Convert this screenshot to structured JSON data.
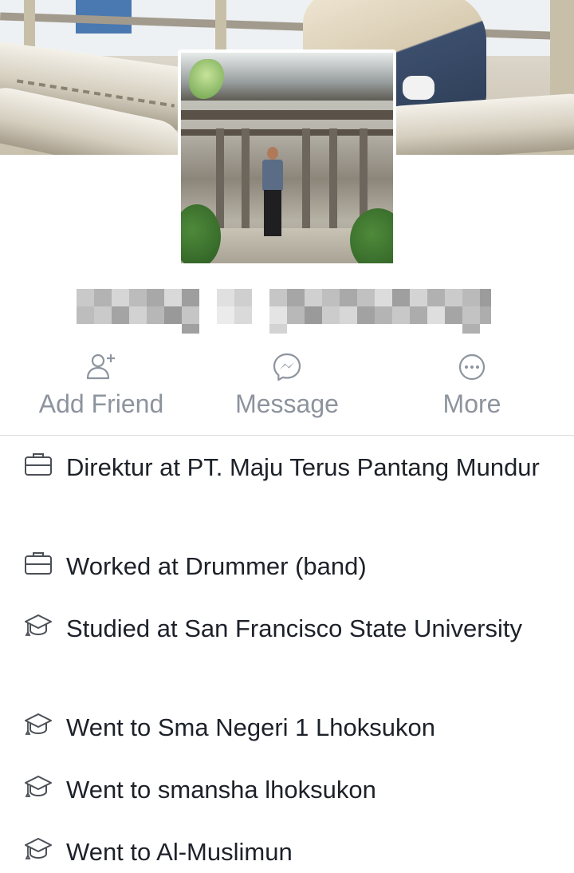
{
  "actions": {
    "add_friend": {
      "label": "Add Friend",
      "icon": "add-friend-icon"
    },
    "message": {
      "label": "Message",
      "icon": "messenger-icon"
    },
    "more": {
      "label": "More",
      "icon": "more-icon"
    }
  },
  "about": [
    {
      "icon": "briefcase-icon",
      "text": "Direktur at PT. Maju Terus Pantang Mundur"
    },
    {
      "icon": "briefcase-icon",
      "text": "Worked at Drummer (band)"
    },
    {
      "icon": "graduation-cap-icon",
      "text": "Studied at San Francisco State University"
    },
    {
      "icon": "graduation-cap-icon",
      "text": "Went to Sma Negeri 1 Lhoksukon"
    },
    {
      "icon": "graduation-cap-icon",
      "text": "Went to smansha lhoksukon"
    },
    {
      "icon": "graduation-cap-icon",
      "text": "Went to Al-Muslimun"
    }
  ],
  "colors": {
    "action_gray": "#8d949e",
    "text_dark": "#1d2129",
    "divider": "#dcdcdc"
  }
}
